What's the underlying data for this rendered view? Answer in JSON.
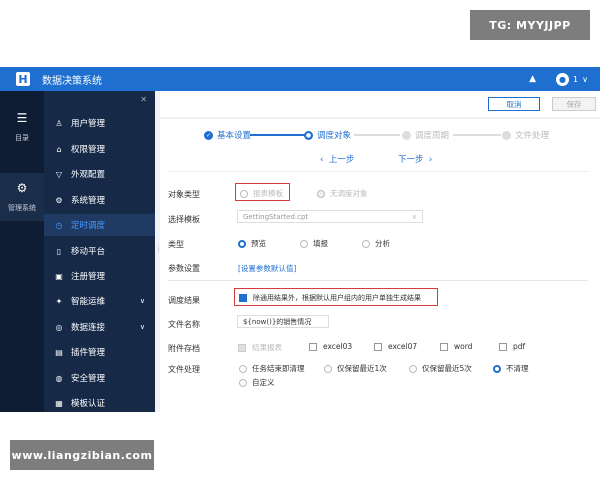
{
  "watermarks": {
    "top_right": "TG: MYYJJPP",
    "bottom_left": "www.liangzibian.com"
  },
  "header": {
    "logo": "H",
    "app_title": "数据决策系统",
    "user_avatar": "1",
    "user_caret": "∨",
    "bell_icon": "bell-icon"
  },
  "rail": {
    "items": [
      {
        "label": "目录",
        "icon": "list-icon"
      },
      {
        "label": "管理系统",
        "icon": "gear-icon",
        "active": true
      }
    ]
  },
  "sidebar": {
    "pin_icon": "pin-icon",
    "items": [
      {
        "label": "用户管理",
        "icon": "user-icon"
      },
      {
        "label": "权限管理",
        "icon": "lock-icon"
      },
      {
        "label": "外观配置",
        "icon": "shirt-icon"
      },
      {
        "label": "系统管理",
        "icon": "gear-icon"
      },
      {
        "label": "定时调度",
        "icon": "clock-icon",
        "active": true
      },
      {
        "label": "移动平台",
        "icon": "mobile-icon"
      },
      {
        "label": "注册管理",
        "icon": "register-icon"
      },
      {
        "label": "智能运维",
        "icon": "ops-icon",
        "expandable": true
      },
      {
        "label": "数据连接",
        "icon": "connection-icon",
        "expandable": true
      },
      {
        "label": "插件管理",
        "icon": "plugin-icon"
      },
      {
        "label": "安全管理",
        "icon": "shield-icon"
      },
      {
        "label": "模板认证",
        "icon": "template-icon"
      }
    ]
  },
  "toolbar": {
    "cancel_label": "取消",
    "save_label": "保存"
  },
  "steps": [
    {
      "label": "基本设置",
      "state": "done"
    },
    {
      "label": "调度对象",
      "state": "current"
    },
    {
      "label": "调度周期",
      "state": "todo"
    },
    {
      "label": "文件处理",
      "state": "todo"
    }
  ],
  "nav": {
    "prev": "上一步",
    "next": "下一步",
    "prev_icon": "‹",
    "next_icon": "›"
  },
  "form": {
    "object_type": {
      "label": "对象类型",
      "options": [
        "报表模板",
        "无调度对象"
      ]
    },
    "template": {
      "label": "选择模板",
      "value": "GettingStarted.cpt"
    },
    "type": {
      "label": "类型",
      "options": [
        "预览",
        "填报",
        "分析"
      ]
    },
    "params": {
      "label": "参数设置",
      "link": "[设置参数默认值]"
    },
    "result": {
      "label": "调度结果",
      "checkbox_text": "除通用结果外，根据默认用户组内的用户单独生成结果"
    },
    "filename": {
      "label": "文件名称",
      "value": "${now()}的销售情况"
    },
    "attachment": {
      "label": "附件存档",
      "options": [
        "结果报表",
        "excel03",
        "excel07",
        "word",
        "pdf"
      ]
    },
    "file_handling": {
      "label": "文件处理",
      "options": [
        "任务结束即清理",
        "仅保留最近1次",
        "仅保留最近5次",
        "不清理",
        "自定义"
      ]
    }
  }
}
